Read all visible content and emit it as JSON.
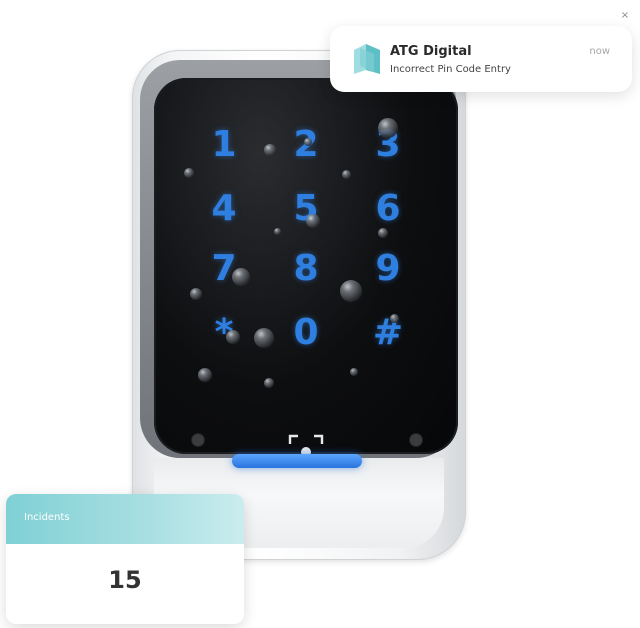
{
  "keypad": {
    "keys": [
      "1",
      "2",
      "3",
      "4",
      "5",
      "6",
      "7",
      "8",
      "9",
      "*",
      "0",
      "#"
    ],
    "key_color": "#2f7fe0",
    "indicator_color": "#2a74dc"
  },
  "notification": {
    "app_name": "ATG Digital",
    "message": "Incorrect Pin Code Entry",
    "time": "now",
    "close_symbol": "×",
    "brand_color": "#7fcfd4"
  },
  "incidents": {
    "label": "Incidents",
    "count": "15",
    "header_color": "#7fd0d5"
  }
}
